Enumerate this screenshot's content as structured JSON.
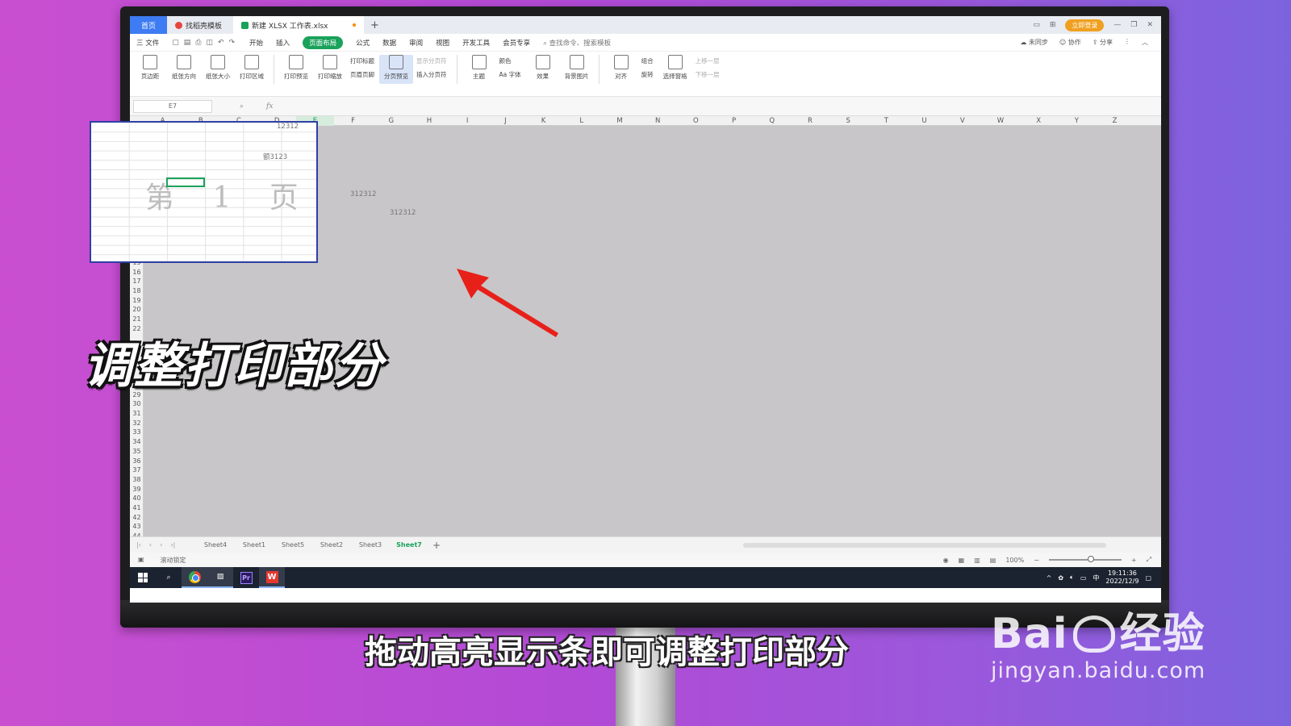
{
  "tabs": {
    "home": "首页",
    "template": "找稻壳模板",
    "doc": "新建 XLSX 工作表.xlsx",
    "login": "立即登录"
  },
  "menu": {
    "file": "三 文件",
    "items": [
      "开始",
      "插入",
      "页面布局",
      "公式",
      "数据",
      "审阅",
      "视图",
      "开发工具",
      "会员专享"
    ],
    "active": "页面布局",
    "search": "查找命令、搜索模板",
    "sync": "未同步",
    "collab": "协作",
    "share": "分享"
  },
  "ribbon": {
    "margins": "页边距",
    "orientation": "纸张方向",
    "size": "纸张大小",
    "print_area": "打印区域",
    "print_preview": "打印预览",
    "print_scale": "打印缩放",
    "print_titles": "打印标题",
    "header_footer": "页眉页脚",
    "page_break_preview": "分页预览",
    "show_breaks": "显示分页符",
    "insert_break": "插入分页符",
    "theme": "主题",
    "colors": "颜色",
    "fonts": "Aa 字体",
    "effects": "效果",
    "background": "背景图片",
    "align": "对齐",
    "group": "组合",
    "rotate": "旋转",
    "selection_pane": "选择窗格",
    "bring_forward": "上移一层",
    "send_backward": "下移一层"
  },
  "formula_bar": {
    "name_box": "E7",
    "fx": "fx"
  },
  "grid": {
    "columns": [
      "A",
      "B",
      "C",
      "D",
      "E",
      "F",
      "G",
      "H",
      "I",
      "J",
      "K",
      "L",
      "M",
      "N",
      "O",
      "P",
      "Q",
      "R",
      "S",
      "T",
      "U",
      "V",
      "W",
      "X",
      "Y",
      "Z"
    ],
    "selected_column": "E",
    "rows": [
      "1",
      "2",
      "3",
      "4",
      "5",
      "6",
      "7",
      "8",
      "9",
      "10",
      "11",
      "12",
      "13",
      "14",
      "15",
      "16",
      "17",
      "18",
      "19",
      "20",
      "21",
      "22",
      "28",
      "29",
      "30",
      "31",
      "32",
      "33",
      "34",
      "35",
      "36",
      "37",
      "38",
      "39",
      "40",
      "41",
      "42",
      "43",
      "44"
    ],
    "page_watermark": "第 1 页",
    "cells": {
      "d1": "12312",
      "c4": "额3123",
      "f8": "312312",
      "g10": "312312"
    }
  },
  "sheets": {
    "tabs": [
      "Sheet4",
      "Sheet1",
      "Sheet5",
      "Sheet2",
      "Sheet3",
      "Sheet7"
    ],
    "active": "Sheet7",
    "add": "+"
  },
  "status": {
    "scroll_lock": "滚动锁定",
    "zoom": "100%",
    "zoom_level": 0.58
  },
  "taskbar": {
    "time": "19:11:36",
    "date": "2022/12/9",
    "ime": "中"
  },
  "overlay": {
    "title": "调整打印部分",
    "subtitle": "拖动高亮显示条即可调整打印部分"
  },
  "watermark": {
    "brand_left": "Bai",
    "brand_right": "经验",
    "url": "jingyan.baidu.com"
  },
  "colors": {
    "accent_green": "#1aa25b",
    "print_border": "#2e3fa4",
    "arrow_red": "#e8201a",
    "background_purple": "#b24ad6"
  }
}
